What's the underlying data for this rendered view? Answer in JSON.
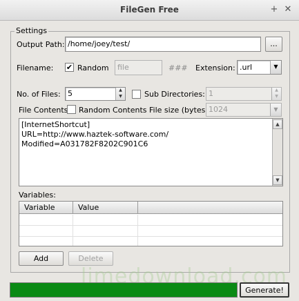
{
  "window": {
    "title": "FileGen Free"
  },
  "settings": {
    "group_label": "Settings",
    "output_path_label": "Output Path:",
    "output_path_value": "/home/joey/test/",
    "browse_label": "...",
    "filename_label": "Filename:",
    "random_label": "Random",
    "random_checked": "✔",
    "filename_placeholder": "file",
    "hash_label": "###",
    "extension_label": "Extension:",
    "extension_value": ".url",
    "num_files_label": "No. of Files:",
    "num_files_value": "5",
    "subdirs_label": "Sub Directories:",
    "subdirs_value": "1",
    "file_contents_label": "File Contents",
    "random_contents_label": "Random Contents",
    "file_size_label": "File size (bytes)",
    "file_size_value": "1024",
    "contents_lines": [
      "[InternetShortcut]",
      "URL=http://www.haztek-software.com/",
      "Modified=A031782F8202C901C6"
    ]
  },
  "variables": {
    "label": "Variables:",
    "columns": [
      "Variable",
      "Value"
    ],
    "add_label": "Add",
    "delete_label": "Delete"
  },
  "footer": {
    "progress_fraction": 1.0,
    "progress_color": "#0a8a14",
    "generate_label": "Generate!"
  },
  "watermark": "limedownload.com",
  "icons": {
    "maximize": "+",
    "close": "✕",
    "up_arrow": "▲",
    "down_arrow": "▼"
  }
}
